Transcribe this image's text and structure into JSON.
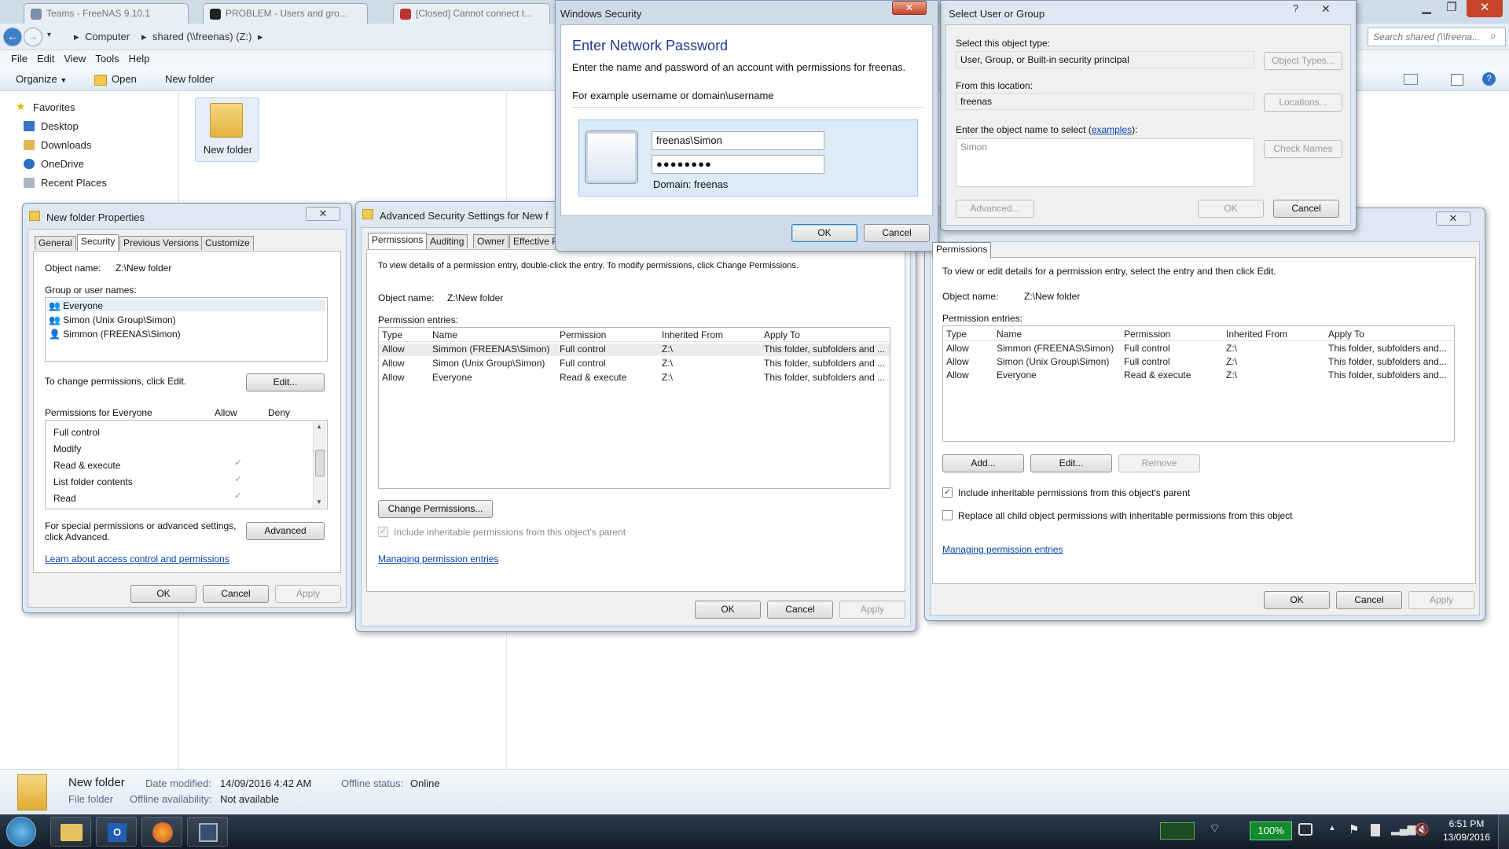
{
  "browser_tabs": [
    {
      "label": "Teams - FreeNAS 9.10.1"
    },
    {
      "label": "PROBLEM - Users and gro..."
    },
    {
      "label": "[Closed] Cannot connect t..."
    }
  ],
  "explorer": {
    "breadcrumb": [
      "Computer",
      "shared (\\\\freenas) (Z:)"
    ],
    "search_placeholder": "Search shared (\\\\freena...",
    "menu": [
      "File",
      "Edit",
      "View",
      "Tools",
      "Help"
    ],
    "commands": {
      "organize": "Organize",
      "open": "Open",
      "new_folder": "New folder"
    },
    "nav": {
      "favorites": "Favorites",
      "items": [
        "Desktop",
        "Downloads",
        "OneDrive",
        "Recent Places"
      ]
    },
    "folder_label": "New folder",
    "details": {
      "name": "New folder",
      "type": "File folder",
      "date_modified_label": "Date modified:",
      "date_modified": "14/09/2016 4:42 AM",
      "offline_availability_label": "Offline availability:",
      "offline_availability": "Not available",
      "offline_status_label": "Offline status:",
      "offline_status": "Online"
    }
  },
  "properties": {
    "title": "New folder Properties",
    "tabs": [
      "General",
      "Security",
      "Previous Versions",
      "Customize"
    ],
    "object_name_label": "Object name:",
    "object_name": "Z:\\New folder",
    "group_label": "Group or user names:",
    "groups": [
      "Everyone",
      "Simon (Unix Group\\Simon)",
      "Simmon (FREENAS\\Simon)"
    ],
    "change_text": "To change permissions, click Edit.",
    "edit": "Edit...",
    "perm_for": "Permissions for Everyone",
    "allow": "Allow",
    "deny": "Deny",
    "perms": [
      {
        "name": "Full control",
        "allow": ""
      },
      {
        "name": "Modify",
        "allow": ""
      },
      {
        "name": "Read & execute",
        "allow": "✓"
      },
      {
        "name": "List folder contents",
        "allow": "✓"
      },
      {
        "name": "Read",
        "allow": "✓"
      }
    ],
    "special_text_1": "For special permissions or advanced settings,",
    "special_text_2": "click Advanced.",
    "advanced": "Advanced",
    "learn_link": "Learn about access control and permissions",
    "ok": "OK",
    "cancel": "Cancel",
    "apply": "Apply"
  },
  "advanced": {
    "title": "Advanced Security Settings for New f",
    "tabs": [
      "Permissions",
      "Auditing",
      "Owner",
      "Effective Pe"
    ],
    "info": "To view details of a permission entry, double-click the entry. To modify permissions, click Change Permissions.",
    "object_name_label": "Object name:",
    "object_name": "Z:\\New folder",
    "entries_label": "Permission entries:",
    "columns": [
      "Type",
      "Name",
      "Permission",
      "Inherited From",
      "Apply To"
    ],
    "rows": [
      [
        "Allow",
        "Simmon (FREENAS\\Simon)",
        "Full control",
        "Z:\\",
        "This folder, subfolders and ..."
      ],
      [
        "Allow",
        "Simon (Unix Group\\Simon)",
        "Full control",
        "Z:\\",
        "This folder, subfolders and ..."
      ],
      [
        "Allow",
        "Everyone",
        "Read & execute",
        "Z:\\",
        "This folder, subfolders and ..."
      ]
    ],
    "change_permissions": "Change Permissions...",
    "include_text": "Include inheritable permissions from this object's parent",
    "managing_link": "Managing permission entries",
    "ok": "OK",
    "cancel": "Cancel",
    "apply": "Apply"
  },
  "perm_dialog": {
    "tab": "Permissions",
    "info": "To view or edit details for a permission entry, select the entry and then click Edit.",
    "object_name_label": "Object name:",
    "object_name": "Z:\\New folder",
    "entries_label": "Permission entries:",
    "columns": [
      "Type",
      "Name",
      "Permission",
      "Inherited From",
      "Apply To"
    ],
    "rows": [
      [
        "Allow",
        "Simmon (FREENAS\\Simon)",
        "Full control",
        "Z:\\",
        "This folder, subfolders and..."
      ],
      [
        "Allow",
        "Simon (Unix Group\\Simon)",
        "Full control",
        "Z:\\",
        "This folder, subfolders and..."
      ],
      [
        "Allow",
        "Everyone",
        "Read & execute",
        "Z:\\",
        "This folder, subfolders and..."
      ]
    ],
    "add": "Add...",
    "edit": "Edit...",
    "remove": "Remove",
    "include_text": "Include inheritable permissions from this object's parent",
    "replace_text": "Replace all child object permissions with inheritable permissions from this object",
    "managing_link": "Managing permission entries",
    "ok": "OK",
    "cancel": "Cancel",
    "apply": "Apply"
  },
  "winsec": {
    "title": "Windows Security",
    "heading": "Enter Network Password",
    "desc": "Enter the name and password of an account with permissions for freenas.",
    "example": "For example username or domain\\username",
    "username": "freenas\\Simon",
    "password": "●●●●●●●●",
    "domain": "Domain: freenas",
    "ok": "OK",
    "cancel": "Cancel"
  },
  "select_user": {
    "title": "Select User or Group",
    "help": "?",
    "object_type_label": "Select this object type:",
    "object_type": "User, Group, or Built-in security principal",
    "object_types_btn": "Object Types...",
    "location_label": "From this location:",
    "location": "freenas",
    "locations_btn": "Locations...",
    "enter_label": "Enter the object name to select (",
    "examples_link": "examples",
    "enter_label_end": "):",
    "object_name": "Simon",
    "check_names": "Check Names",
    "advanced": "Advanced...",
    "ok": "OK",
    "cancel": "Cancel"
  },
  "taskbar": {
    "zoom": "100%",
    "time": "6:51 PM",
    "date": "13/09/2016"
  }
}
